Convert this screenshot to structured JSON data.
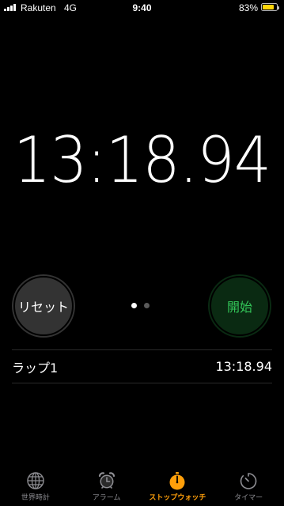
{
  "status_bar": {
    "carrier": "Rakuten",
    "network": "4G",
    "time": "9:40",
    "battery_percent": "83%",
    "battery_level": 0.83
  },
  "stopwatch": {
    "time": "13:18.94"
  },
  "buttons": {
    "reset_label": "リセット",
    "start_label": "開始"
  },
  "pager": {
    "page_count": 2,
    "current_page": 1
  },
  "laps": [
    {
      "label": "ラップ1",
      "time": "13:18.94"
    }
  ],
  "tabs": [
    {
      "label": "世界時計",
      "icon": "globe-icon",
      "active": false
    },
    {
      "label": "アラーム",
      "icon": "alarm-clock-icon",
      "active": false
    },
    {
      "label": "ストップウォッチ",
      "icon": "stopwatch-icon",
      "active": true
    },
    {
      "label": "タイマー",
      "icon": "timer-icon",
      "active": false
    }
  ],
  "colors": {
    "accent": "#ff9f0a",
    "start_green": "#33c759",
    "battery": "#ffd60a",
    "inactive_tab": "#8e8e93"
  }
}
